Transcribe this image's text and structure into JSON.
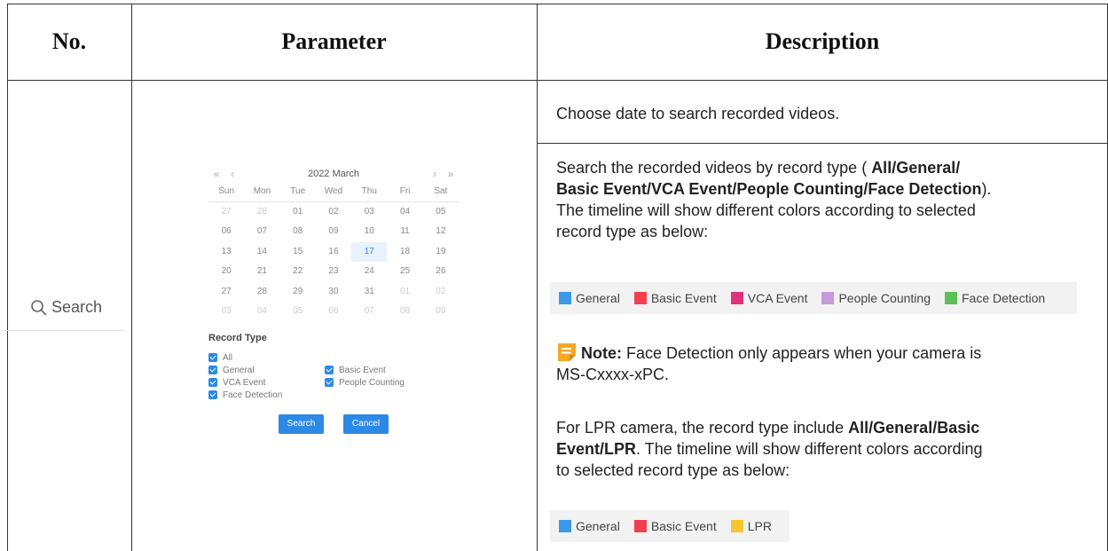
{
  "header": {
    "no": "No.",
    "parameter": "Parameter",
    "description": "Description"
  },
  "row": {
    "search_label": "Search",
    "calendar": {
      "prev_year": "«",
      "prev_month": "‹",
      "title": "2022 March",
      "next_month": "›",
      "next_year": "»",
      "weekdays": [
        "Sun",
        "Mon",
        "Tue",
        "Wed",
        "Thu",
        "Fri",
        "Sat"
      ],
      "weeks": [
        [
          "27",
          "28",
          "01",
          "02",
          "03",
          "04",
          "05"
        ],
        [
          "06",
          "07",
          "08",
          "09",
          "10",
          "11",
          "12"
        ],
        [
          "13",
          "14",
          "15",
          "16",
          "17",
          "18",
          "19"
        ],
        [
          "20",
          "21",
          "22",
          "23",
          "24",
          "25",
          "26"
        ],
        [
          "27",
          "28",
          "29",
          "30",
          "31",
          "01",
          "02"
        ],
        [
          "03",
          "04",
          "05",
          "06",
          "07",
          "08",
          "09"
        ]
      ],
      "selected_day": "17"
    },
    "record_type": {
      "title": "Record Type",
      "options": {
        "all": "All",
        "general": "General",
        "basic_event": "Basic Event",
        "vca_event": "VCA Event",
        "people_counting": "People Counting",
        "face_detection": "Face Detection"
      },
      "search_button": "Search",
      "cancel_button": "Cancel"
    }
  },
  "description": {
    "choose_date": "Choose date to search recorded videos.",
    "search_by_prefix": "Search the recorded videos by record type ( ",
    "search_by_types_line1": "All/General/",
    "search_by_types_line2": "Basic Event/VCA Event/People Counting/Face Detection",
    "search_by_suffix": ").",
    "timeline_text_line1": "The timeline will show different colors according to selected",
    "timeline_text_line2": "record type as below:",
    "legend1": [
      {
        "label": "General",
        "color": "#3b9ae8"
      },
      {
        "label": "Basic Event",
        "color": "#f0404f"
      },
      {
        "label": "VCA Event",
        "color": "#e0307d"
      },
      {
        "label": "People Counting",
        "color": "#c49ad8"
      },
      {
        "label": "Face Detection",
        "color": "#5bbf5a"
      }
    ],
    "note_label": "Note:",
    "note_text_line1": " Face Detection only appears when your camera is",
    "note_text_line2": "MS-Cxxxx-xPC.",
    "lpr_prefix": "For LPR camera, the record type include ",
    "lpr_types_line1": "All/General/Basic",
    "lpr_types_line2": "Event/LPR",
    "lpr_suffix_line2": ". The timeline will show different colors according",
    "lpr_line3": "to selected record type as below:",
    "legend2": [
      {
        "label": "General",
        "color": "#3b9ae8"
      },
      {
        "label": "Basic Event",
        "color": "#f0404f"
      },
      {
        "label": "LPR",
        "color": "#f7c531"
      }
    ]
  },
  "colors": {
    "accent": "#2d89e6",
    "note_icon": "#f7a824"
  }
}
